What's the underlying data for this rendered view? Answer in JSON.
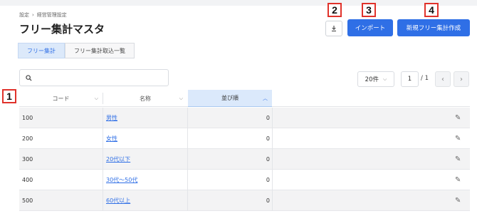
{
  "breadcrumb": {
    "item1": "設定",
    "separator": "›",
    "item2": "経営管理設定"
  },
  "page_title": "フリー集計マスタ",
  "actions": {
    "import_label": "インポート",
    "create_label": "新規フリー集計作成"
  },
  "markers": {
    "m1": "1",
    "m2": "2",
    "m3": "3",
    "m4": "4"
  },
  "tabs": [
    {
      "label": "フリー集計"
    },
    {
      "label": "フリー集計取込一覧"
    }
  ],
  "search": {
    "placeholder": "",
    "value": ""
  },
  "pagination": {
    "per_page": "20件",
    "current_page": "1",
    "total": "/ 1"
  },
  "table": {
    "columns": [
      {
        "label": "コード"
      },
      {
        "label": "名称"
      },
      {
        "label": "並び順"
      }
    ],
    "rows": [
      {
        "code": "100",
        "name": "男性",
        "order": "0"
      },
      {
        "code": "200",
        "name": "女性",
        "order": "0"
      },
      {
        "code": "300",
        "name": "20代以下",
        "order": "0"
      },
      {
        "code": "400",
        "name": "30代～50代",
        "order": "0"
      },
      {
        "code": "500",
        "name": "60代以上",
        "order": "0"
      }
    ]
  },
  "colors": {
    "primary": "#2f6fe6",
    "marker": "#e0322b",
    "sorted_header": "#dbe9fb"
  }
}
